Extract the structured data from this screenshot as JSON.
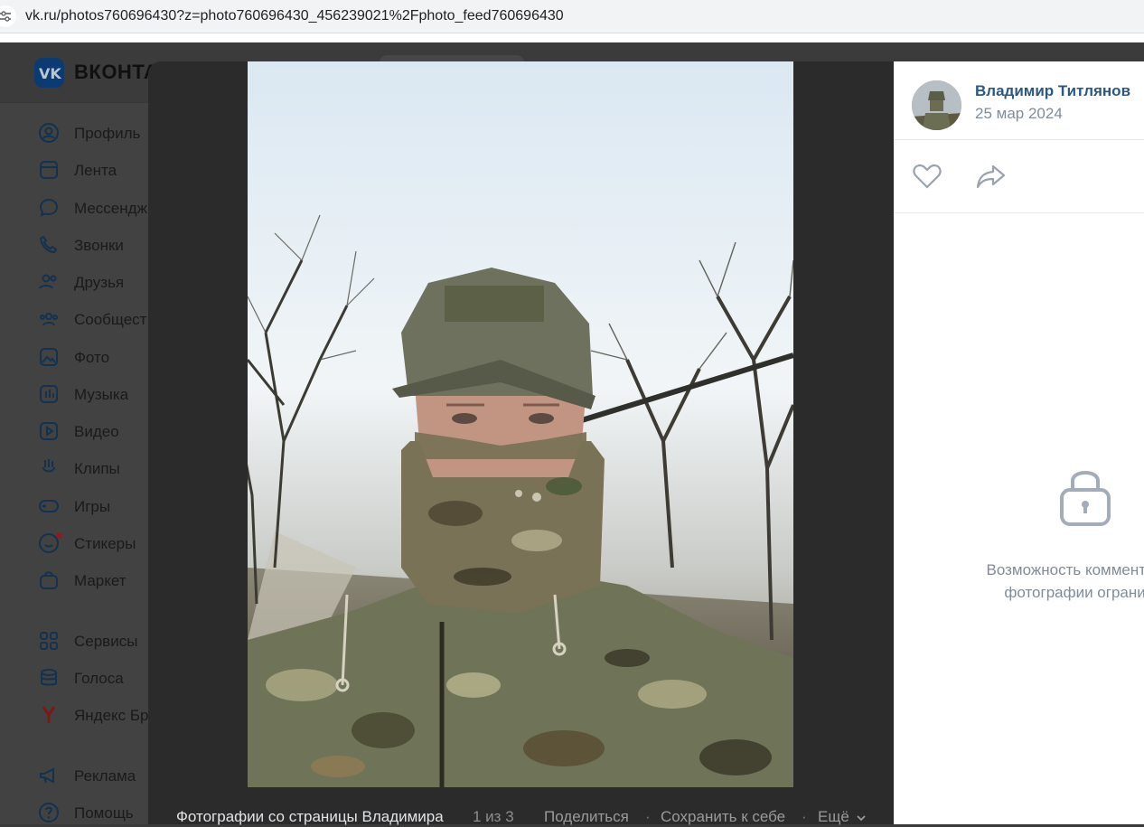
{
  "browser": {
    "url": "vk.ru/photos760696430?z=photo760696430_456239021%2Fphoto_feed760696430"
  },
  "header": {
    "brand": "ВКОНТА"
  },
  "sidebar": {
    "items": [
      {
        "label": "Профиль",
        "icon": "profile-icon"
      },
      {
        "label": "Лента",
        "icon": "feed-icon"
      },
      {
        "label": "Мессендж",
        "icon": "messenger-icon"
      },
      {
        "label": "Звонки",
        "icon": "phone-icon"
      },
      {
        "label": "Друзья",
        "icon": "friends-icon"
      },
      {
        "label": "Сообщест",
        "icon": "communities-icon"
      },
      {
        "label": "Фото",
        "icon": "photo-icon"
      },
      {
        "label": "Музыка",
        "icon": "music-icon"
      },
      {
        "label": "Видео",
        "icon": "video-icon"
      },
      {
        "label": "Клипы",
        "icon": "clips-icon"
      },
      {
        "label": "Игры",
        "icon": "games-icon"
      },
      {
        "label": "Стикеры",
        "icon": "stickers-icon"
      },
      {
        "label": "Маркет",
        "icon": "market-icon"
      },
      {
        "label": "Сервисы",
        "icon": "services-icon"
      },
      {
        "label": "Голоса",
        "icon": "votes-icon"
      },
      {
        "label": "Яндекс Бр",
        "icon": "yandex-icon"
      },
      {
        "label": "Реклама",
        "icon": "ads-icon"
      },
      {
        "label": "Помощь",
        "icon": "help-icon"
      }
    ]
  },
  "viewer": {
    "album_title": "Фотографии со страницы Владимира",
    "counter": "1 из 3",
    "actions": {
      "share": "Поделиться",
      "save": "Сохранить к себе",
      "more": "Ещё"
    },
    "separator": "·"
  },
  "panel": {
    "author_name": "Владимир Титлянов",
    "date": "25 мар 2024",
    "comments_disabled_line1": "Возможность комментиро",
    "comments_disabled_line2": "фотографии огранич"
  },
  "colors": {
    "link": "#2a5885",
    "muted": "#818c99",
    "overlay": "#2b2b2b"
  }
}
